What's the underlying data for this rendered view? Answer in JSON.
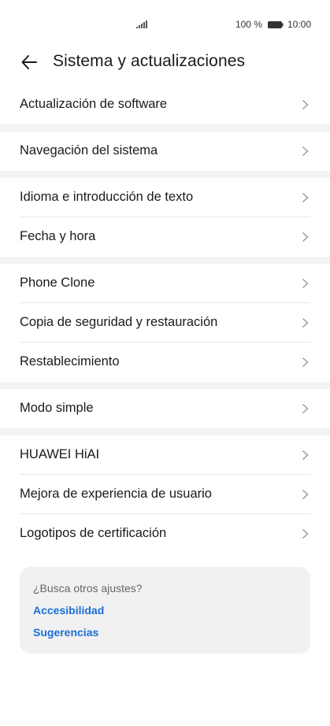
{
  "status_bar": {
    "battery_percent": "100 %",
    "time": "10:00"
  },
  "header": {
    "title": "Sistema y actualizaciones"
  },
  "groups": [
    {
      "items": [
        {
          "label": "Actualización de software"
        }
      ]
    },
    {
      "items": [
        {
          "label": "Navegación del sistema"
        }
      ]
    },
    {
      "items": [
        {
          "label": "Idioma e introducción de texto"
        },
        {
          "label": "Fecha y hora"
        }
      ]
    },
    {
      "items": [
        {
          "label": "Phone Clone"
        },
        {
          "label": "Copia de seguridad y restauración"
        },
        {
          "label": "Restablecimiento"
        }
      ]
    },
    {
      "items": [
        {
          "label": "Modo simple"
        }
      ]
    },
    {
      "items": [
        {
          "label": "HUAWEI HiAI"
        },
        {
          "label": "Mejora de experiencia de usuario"
        },
        {
          "label": "Logotipos de certificación"
        }
      ]
    }
  ],
  "suggestions": {
    "question": "¿Busca otros ajustes?",
    "links": [
      "Accesibilidad",
      "Sugerencias"
    ]
  },
  "colors": {
    "accent": "#1a6fd8",
    "separator": "#f1f3f5",
    "card_bg": "#f1f1f1"
  }
}
